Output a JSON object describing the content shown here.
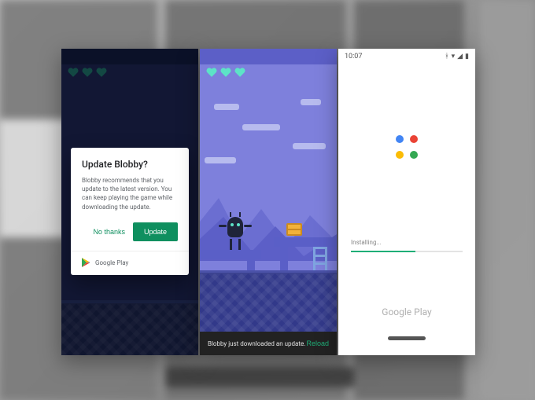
{
  "phone1": {
    "hearts_color": "#1f8f6a",
    "dialog": {
      "title": "Update Blobby?",
      "body": "Blobby recommends that you update to the latest version. You can keep playing the game while downloading the update.",
      "no_label": "No thanks",
      "yes_label": "Update",
      "store_label": "Google Play"
    }
  },
  "phone2": {
    "hearts_color": "#5de3c7",
    "snackbar": {
      "message": "Blobby just downloaded an update.",
      "action": "Reload"
    }
  },
  "phone3": {
    "time": "10:07",
    "installing_label": "Installing...",
    "progress_pct": 58,
    "store_label": "Google Play"
  }
}
